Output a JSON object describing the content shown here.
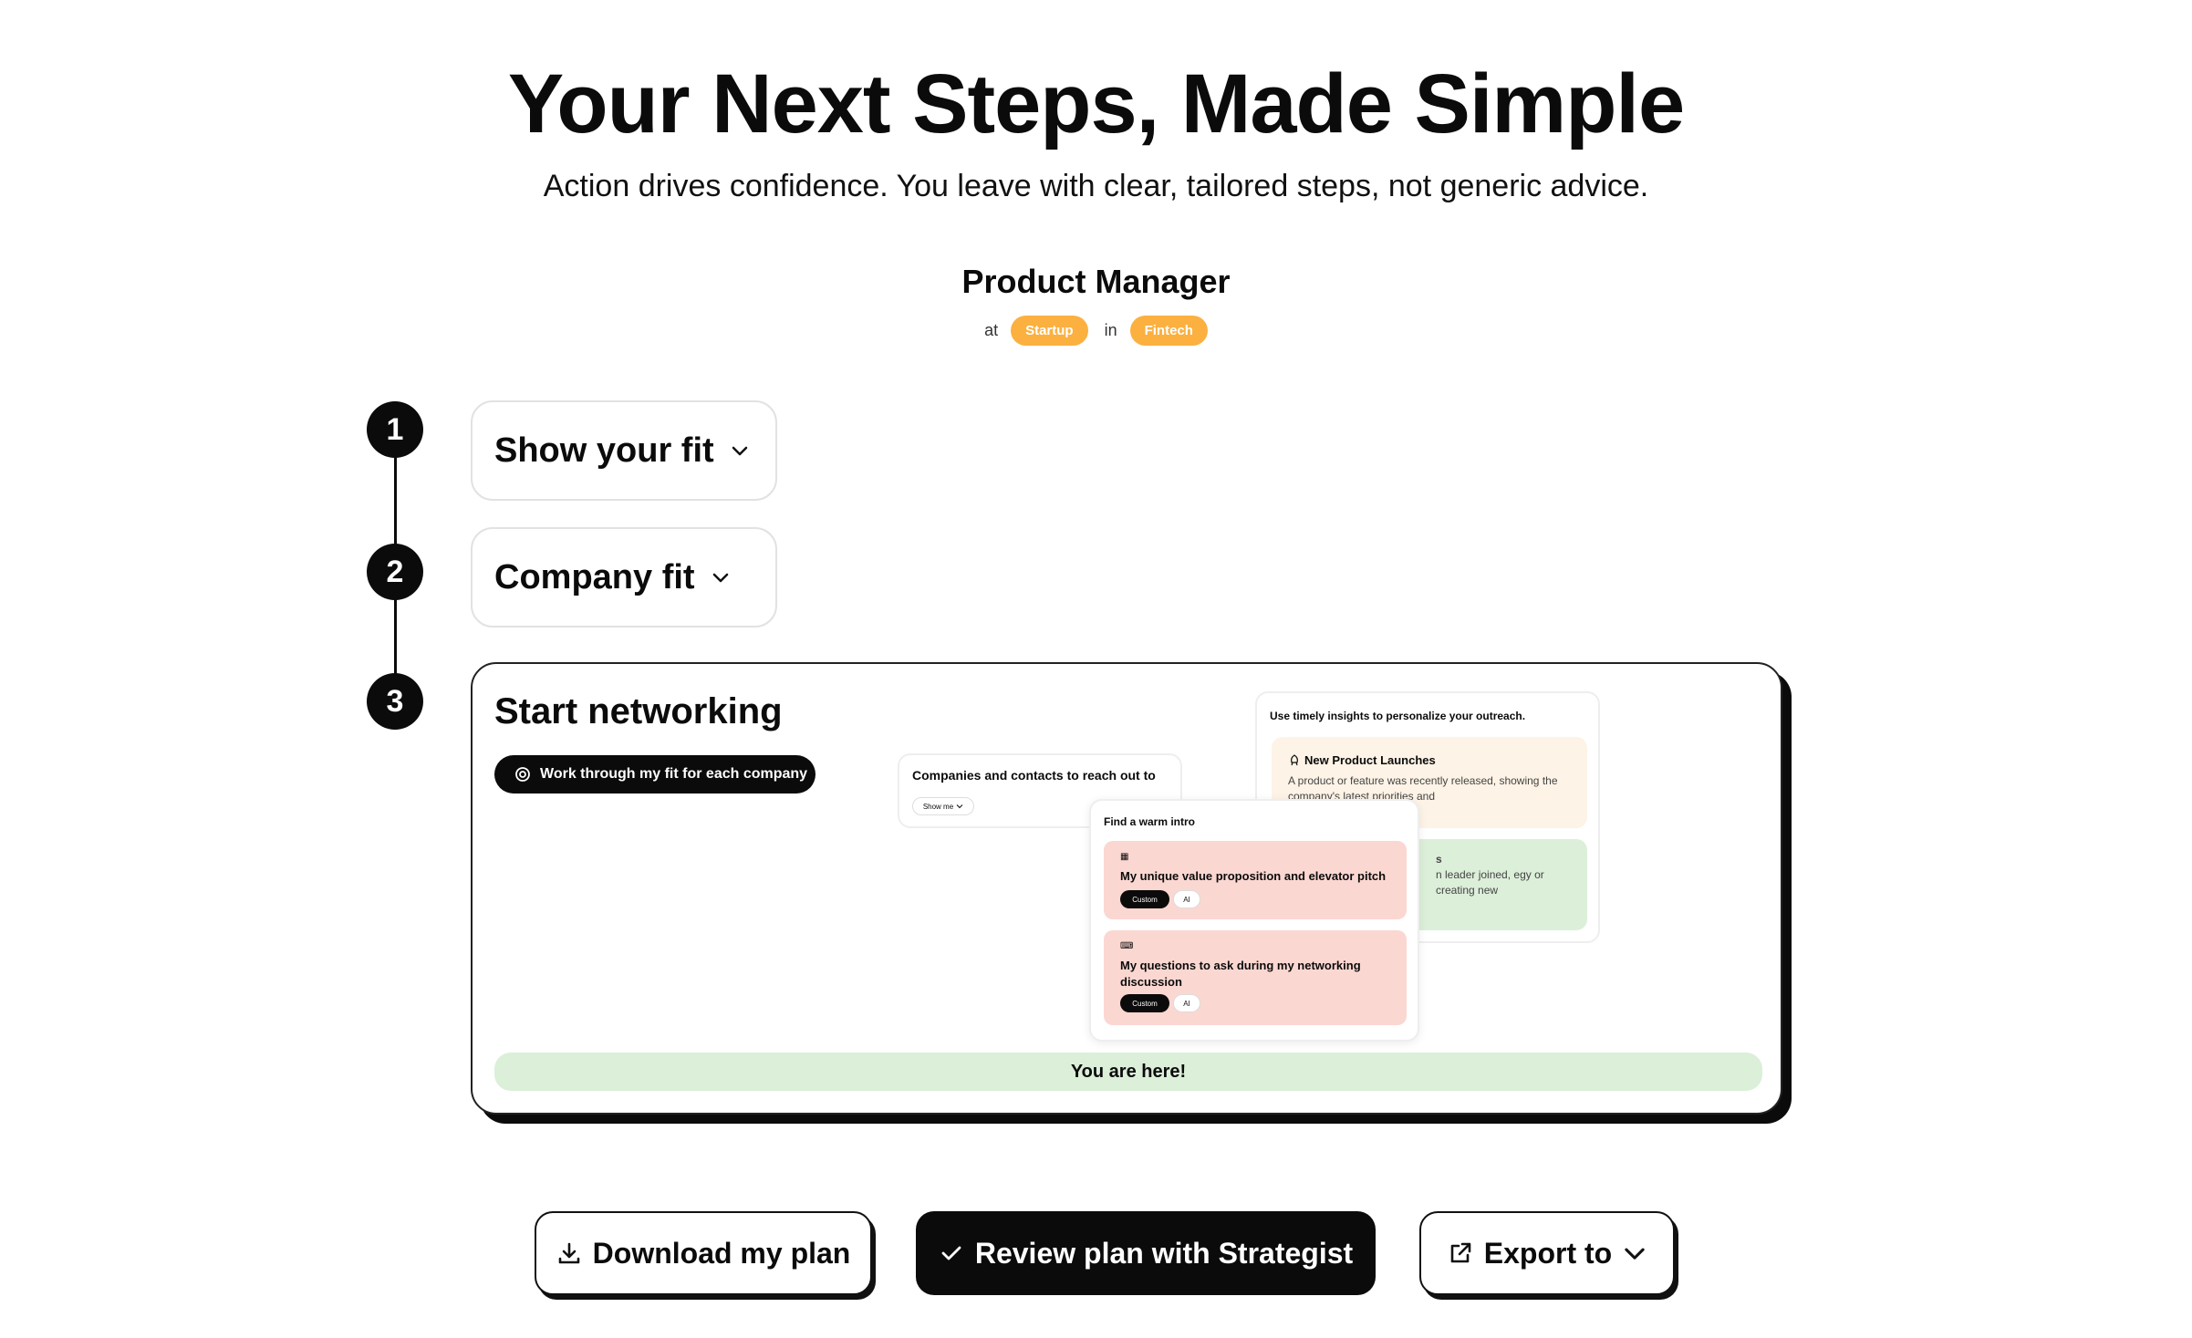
{
  "header": {
    "title": "Your Next Steps, Made Simple",
    "subtitle": "Action drives confidence. You leave with clear, tailored steps, not generic advice."
  },
  "role": {
    "name": "Product Manager",
    "at_label": "at",
    "company_type": "Startup",
    "in_label": "in",
    "industry": "Fintech"
  },
  "steps": [
    {
      "number": "1",
      "label": "Show your fit"
    },
    {
      "number": "2",
      "label": "Company fit"
    },
    {
      "number": "3",
      "label": "Start networking"
    }
  ],
  "networking": {
    "work_button_label": "Work through my fit for each company",
    "you_are_here": "You are here!",
    "companies_card": {
      "title": "Companies and contacts to reach out to",
      "show_me": "Show me"
    },
    "insights_card": {
      "title": "Use timely insights to personalize your outreach.",
      "item1_title": "New Product Launches",
      "item1_desc": "A product or feature was recently released, showing the company's latest priorities and",
      "item2_title": "s",
      "item2_desc": "n leader joined, egy or creating new"
    },
    "intro_card": {
      "title": "Find a warm intro",
      "item1": "My unique value proposition and elevator pitch",
      "item2": "My questions to ask during my networking discussion",
      "tag_custom": "Custom",
      "tag_ai": "AI"
    }
  },
  "actions": {
    "download": "Download my plan",
    "review": "Review plan with Strategist",
    "export": "Export to"
  },
  "colors": {
    "chip": "#fbb040",
    "here_bar": "#dbefd9",
    "insight_orange": "#fdf3e6",
    "insight_green": "#dcefd9",
    "pitch_pink": "#fbd7d1"
  }
}
